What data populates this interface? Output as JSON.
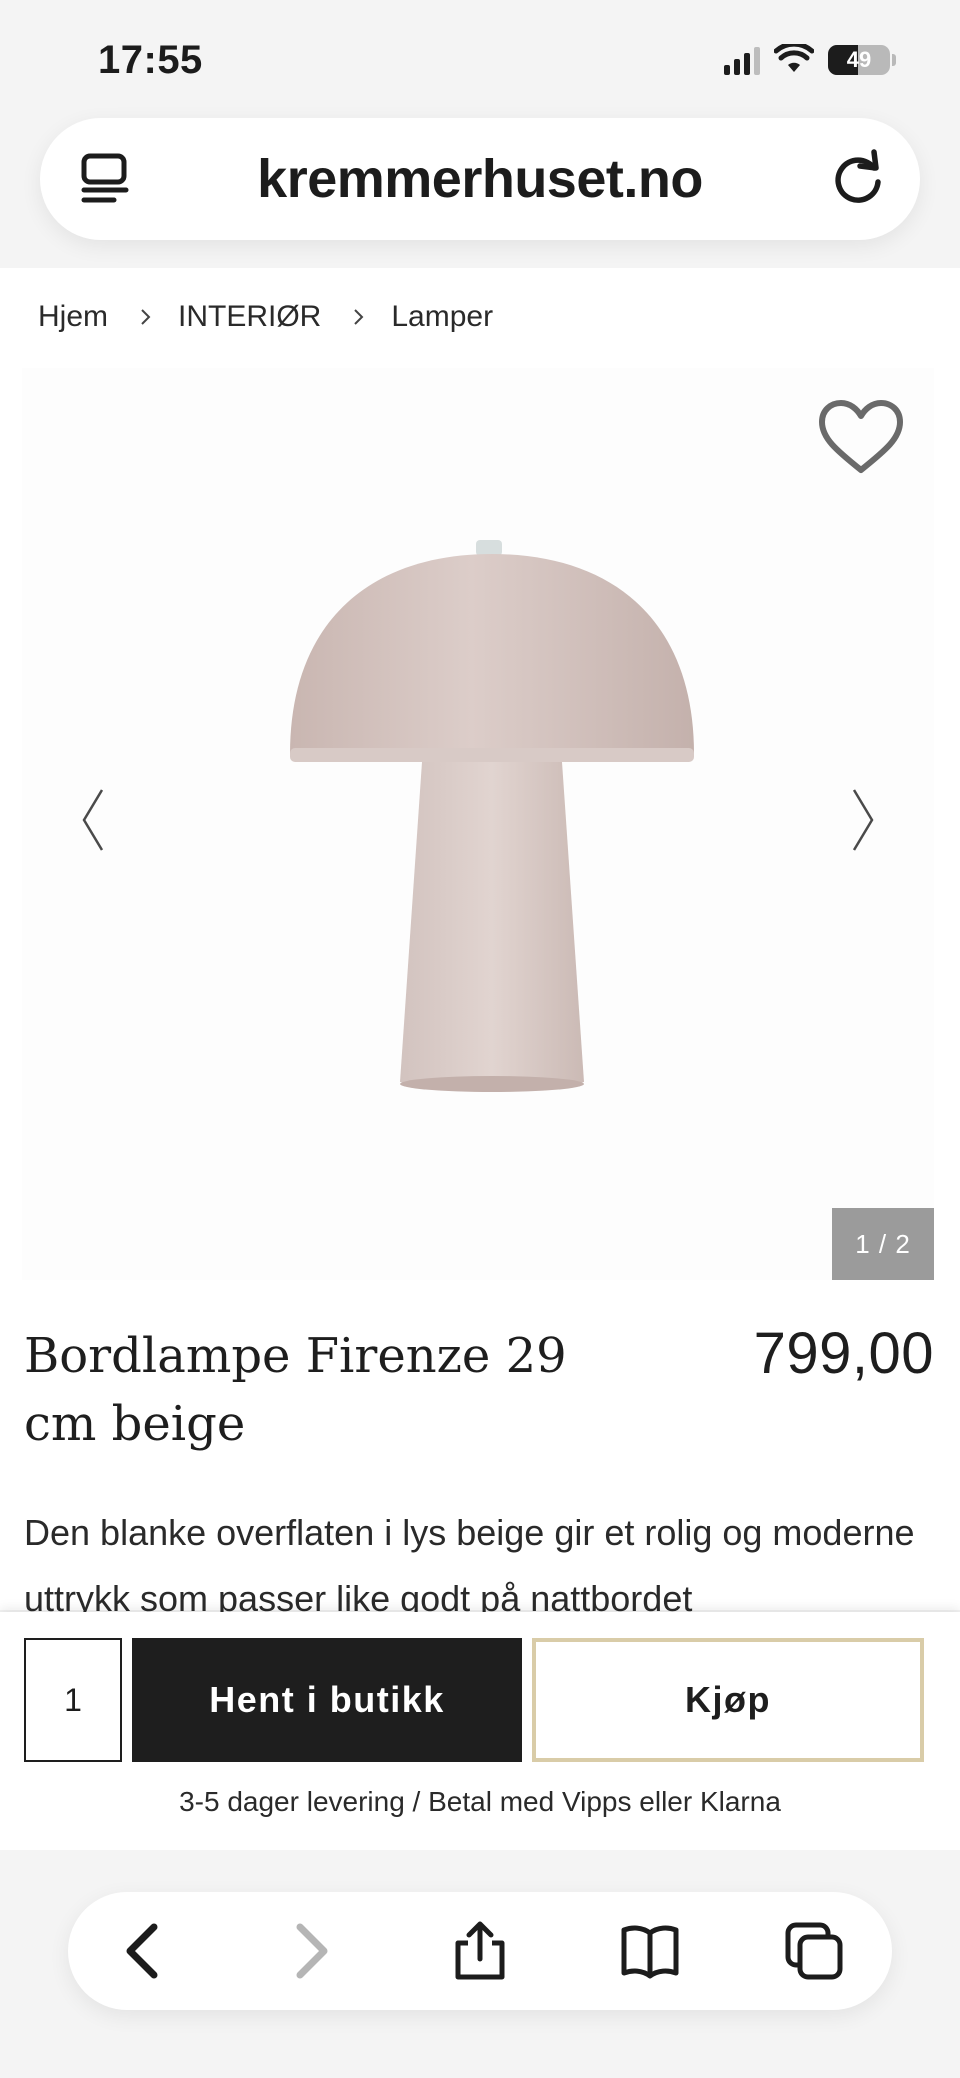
{
  "status_bar": {
    "time": "17:55",
    "battery_level": "49",
    "battery_fraction": 0.49,
    "icons": [
      "signal-icon",
      "wifi-icon",
      "battery-icon"
    ]
  },
  "browser": {
    "url": "kremmerhuset.no",
    "icons": [
      "tab-menu-icon",
      "reload-icon"
    ]
  },
  "breadcrumb": {
    "items": [
      "Hjem",
      "INTERIØR",
      "Lamper"
    ]
  },
  "gallery": {
    "counter": "1 / 2",
    "icons": [
      "heart-icon",
      "chevron-left-icon",
      "chevron-right-icon"
    ]
  },
  "product": {
    "title": "Bordlampe Firenze 29 cm beige",
    "price": "799,00",
    "description": "Den blanke overflaten i lys beige gir et rolig og moderne uttrykk som passer like godt på nattbordet",
    "lamp_color": "#d2c1bd"
  },
  "purchase": {
    "quantity": "1",
    "pickup_label": "Hent i butikk",
    "buy_label": "Kjøp",
    "delivery_note": "3-5 dager levering / Betal med Vipps eller Klarna",
    "buy_border_color": "#d9cca8"
  },
  "toolbar": {
    "icons": [
      "back-icon",
      "forward-icon",
      "share-icon",
      "bookmarks-icon",
      "tabs-icon"
    ]
  }
}
